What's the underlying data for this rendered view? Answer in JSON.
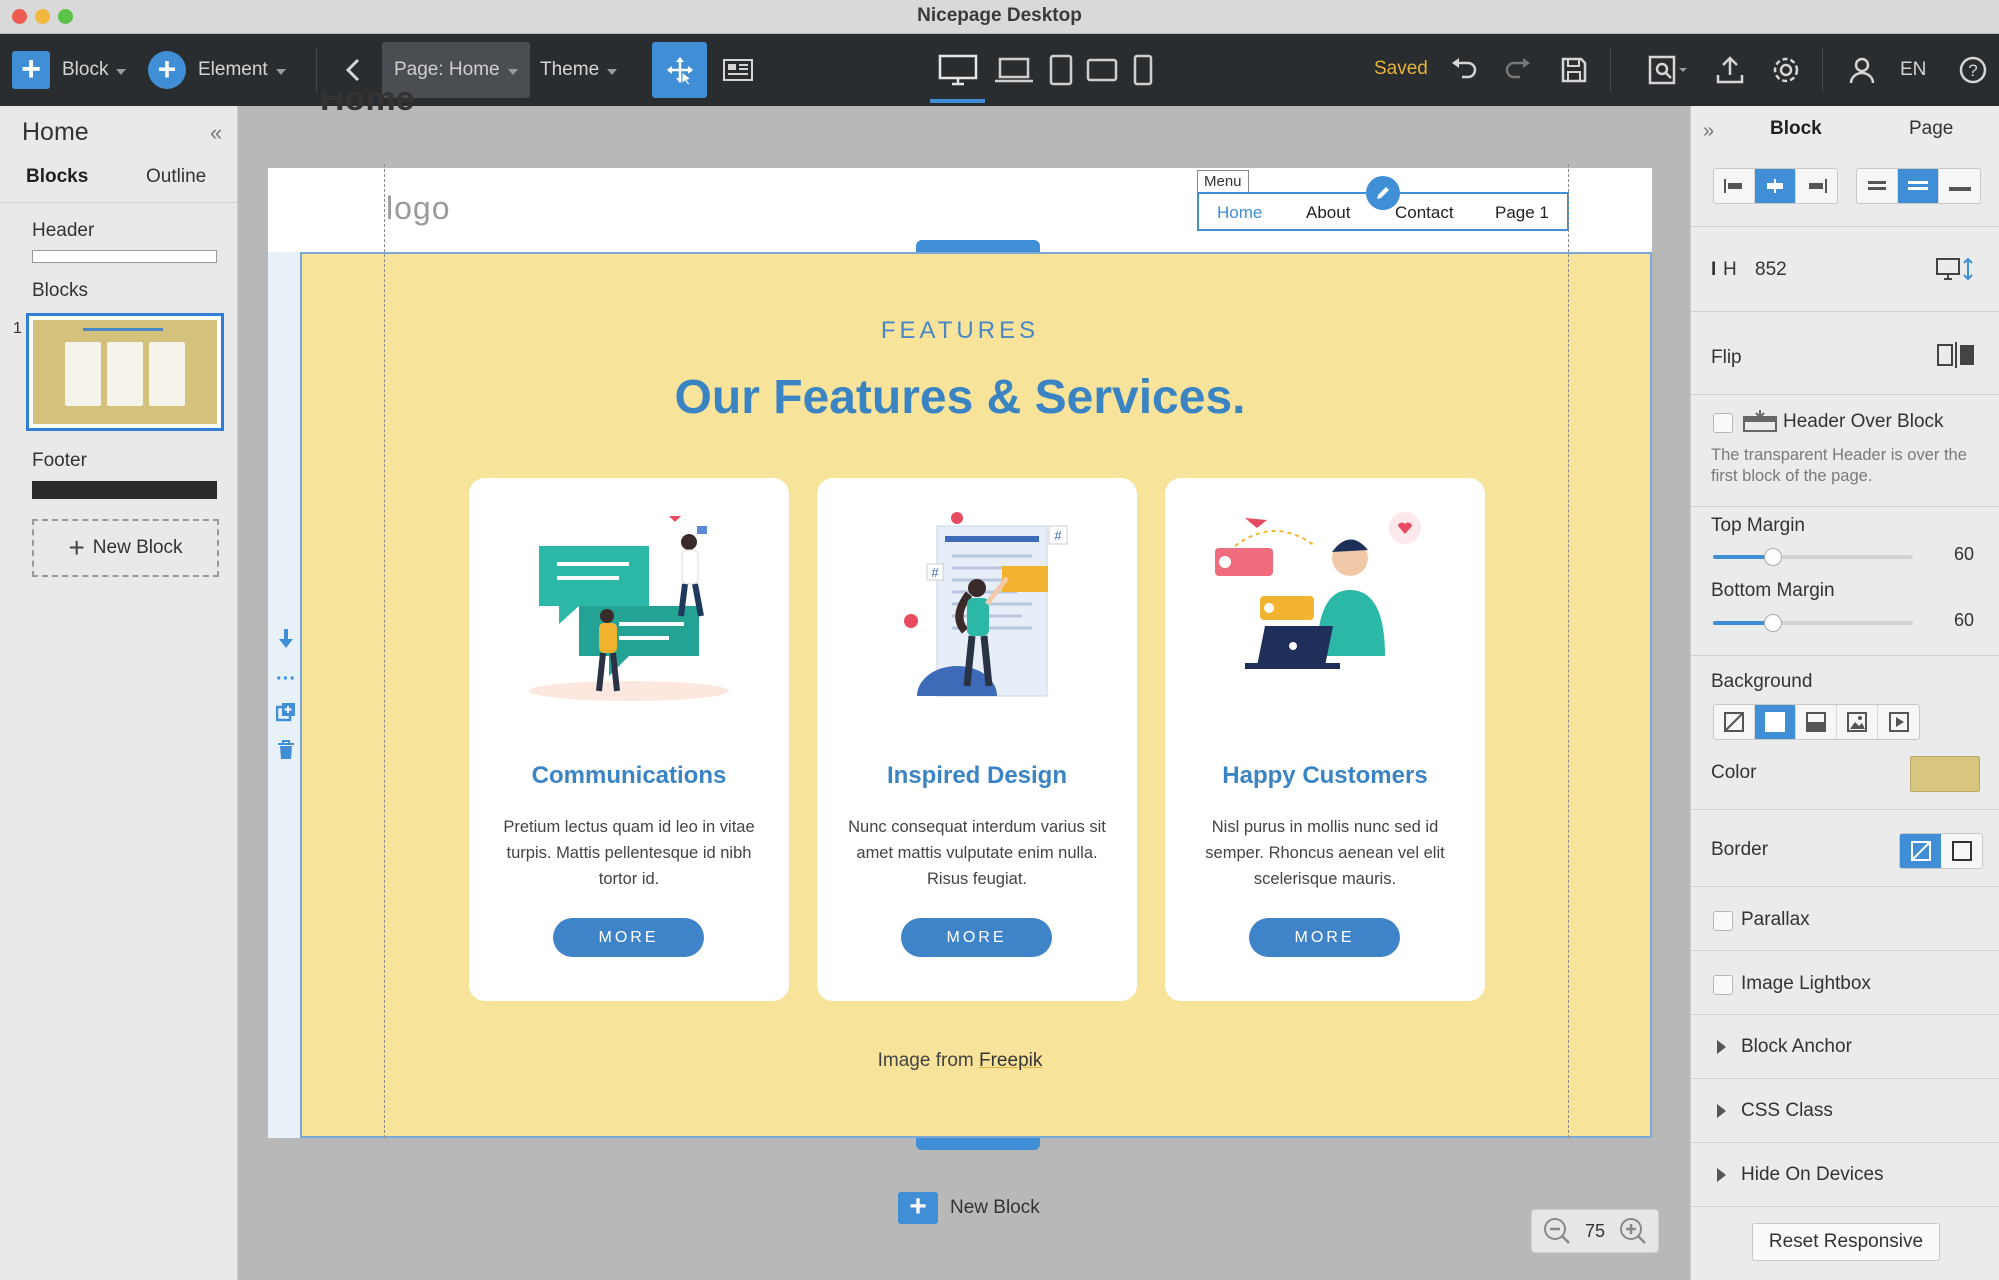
{
  "window": {
    "title": "Nicepage Desktop"
  },
  "colors": {
    "accent": "#3f8ed6",
    "saved": "#e5b33a",
    "block_bg": "#f7e39a",
    "heading": "#3b84c4",
    "bg_swatch": "#d9c67e"
  },
  "toolbar": {
    "block_label": "Block",
    "element_label": "Element",
    "page_label": "Page: Home",
    "theme_label": "Theme",
    "saved_label": "Saved",
    "language": "EN"
  },
  "left_panel": {
    "title": "Home",
    "tabs": [
      "Blocks",
      "Outline"
    ],
    "header_label": "Header",
    "blocks_label": "Blocks",
    "block_number": "1",
    "footer_label": "Footer",
    "new_block_label": "New Block"
  },
  "canvas": {
    "page_heading": "Home",
    "logo": "logo",
    "menu_tag": "Menu",
    "menu_items": [
      "Home",
      "About",
      "Contact",
      "Page 1"
    ],
    "kicker": "FEATURES",
    "title": "Our Features & Services.",
    "cards": [
      {
        "title": "Communications",
        "text": "Pretium lectus quam id leo in vitae turpis. Mattis pellentesque id nibh tortor id.",
        "button": "MORE"
      },
      {
        "title": "Inspired Design",
        "text": "Nunc consequat interdum varius sit amet mattis vulputate enim nulla. Risus feugiat.",
        "button": "MORE"
      },
      {
        "title": "Happy Customers",
        "text": "Nisl purus in mollis nunc sed id semper. Rhoncus aenean vel elit scelerisque mauris.",
        "button": "MORE"
      }
    ],
    "credit_prefix": "Image from",
    "credit_link": "Freepik",
    "new_block_label": "New Block",
    "zoom": "75"
  },
  "right_panel": {
    "tabs": [
      "Block",
      "Page"
    ],
    "height_label": "H",
    "height_value": "852",
    "flip_label": "Flip",
    "header_over_block_label": "Header Over Block",
    "header_over_block_desc": "The transparent Header is over the first block of the page.",
    "top_margin_label": "Top Margin",
    "top_margin_value": "60",
    "top_margin_fraction": 0.3,
    "bottom_margin_label": "Bottom Margin",
    "bottom_margin_value": "60",
    "bottom_margin_fraction": 0.3,
    "background_label": "Background",
    "color_label": "Color",
    "border_label": "Border",
    "parallax_label": "Parallax",
    "image_lightbox_label": "Image Lightbox",
    "block_anchor_label": "Block Anchor",
    "css_class_label": "CSS Class",
    "hide_on_devices_label": "Hide On Devices",
    "reset_responsive_label": "Reset Responsive"
  }
}
